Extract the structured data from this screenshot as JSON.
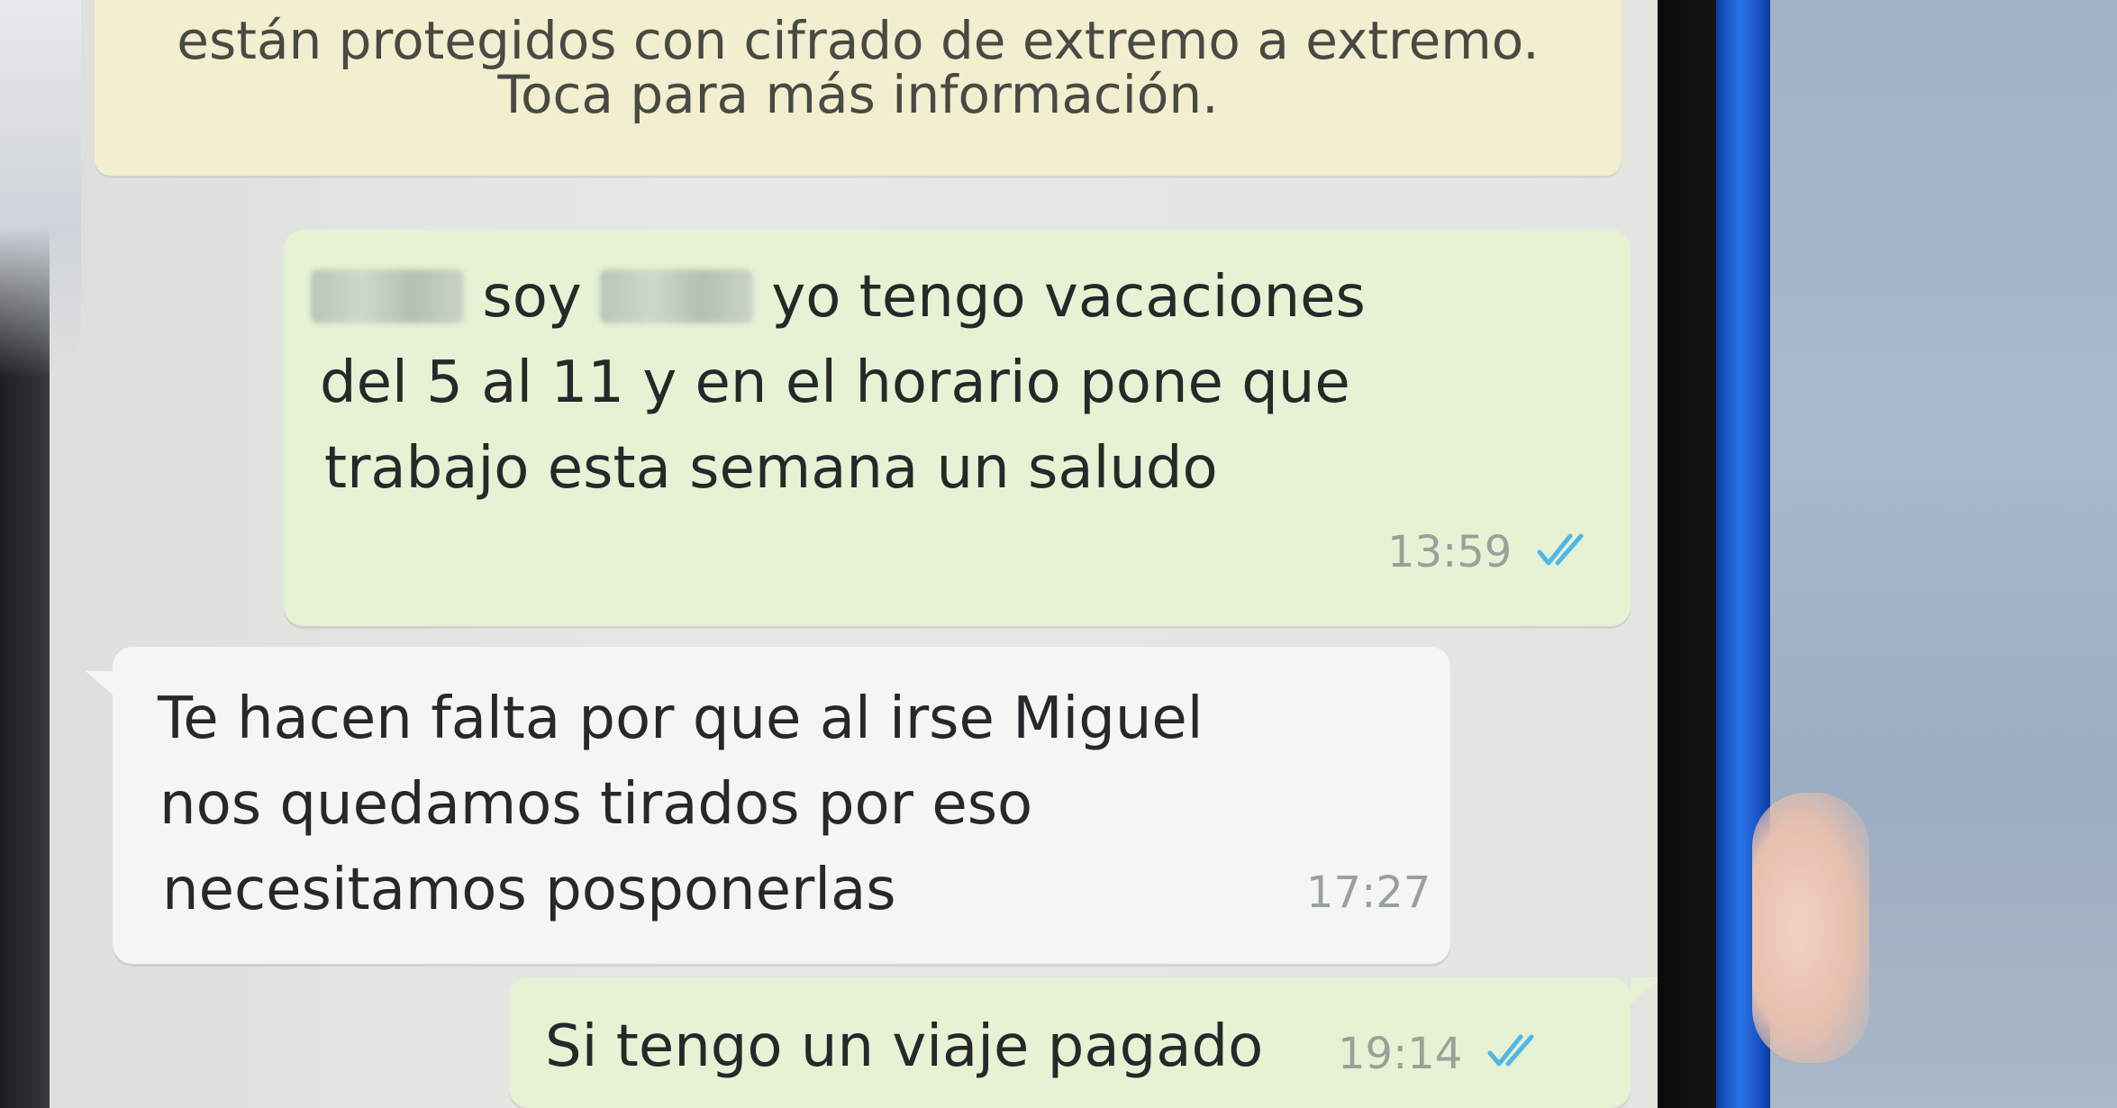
{
  "notice": {
    "line1": "están protegidos con cifrado de extremo a extremo.",
    "line2": "Toca para más información."
  },
  "messages": [
    {
      "direction": "outgoing",
      "lines": [
        "soy",
        "yo tengo vacaciones",
        "del 5 al 11 y en el horario pone que",
        "trabajo esta semana un saludo"
      ],
      "time": "13:59",
      "status_icon": "double-check-read-icon"
    },
    {
      "direction": "incoming",
      "lines": [
        "Te hacen falta por que al irse Miguel",
        "nos quedamos tirados por eso",
        "necesitamos posponerlas"
      ],
      "time": "17:27"
    },
    {
      "direction": "outgoing",
      "lines": [
        "Si tengo un viaje pagado"
      ],
      "time": "19:14",
      "status_icon": "double-check-read-icon"
    }
  ],
  "colors": {
    "outgoing_bubble": "#e6f2d3",
    "incoming_bubble": "#f5f5f4",
    "notice_bubble": "#f1efcf",
    "read_ticks": "#4fb7e6"
  }
}
